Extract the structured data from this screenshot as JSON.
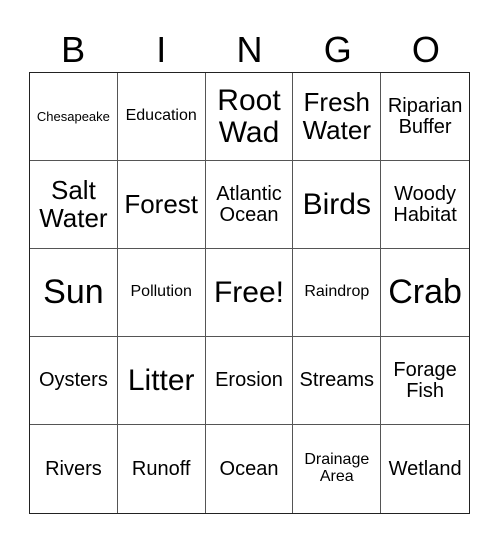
{
  "header": [
    "B",
    "I",
    "N",
    "G",
    "O"
  ],
  "cells": [
    {
      "text": "Chesapeake",
      "size": "s-xs"
    },
    {
      "text": "Education",
      "size": "s-sm"
    },
    {
      "text": "Root Wad",
      "size": "s-xl"
    },
    {
      "text": "Fresh Water",
      "size": "s-lg"
    },
    {
      "text": "Riparian Buffer",
      "size": "s-md"
    },
    {
      "text": "Salt Water",
      "size": "s-lg"
    },
    {
      "text": "Forest",
      "size": "s-lg"
    },
    {
      "text": "Atlantic Ocean",
      "size": "s-md"
    },
    {
      "text": "Birds",
      "size": "s-xl"
    },
    {
      "text": "Woody Habitat",
      "size": "s-md"
    },
    {
      "text": "Sun",
      "size": "s-xxl"
    },
    {
      "text": "Pollution",
      "size": "s-sm"
    },
    {
      "text": "Free!",
      "size": "s-xl"
    },
    {
      "text": "Raindrop",
      "size": "s-sm"
    },
    {
      "text": "Crab",
      "size": "s-xxl"
    },
    {
      "text": "Oysters",
      "size": "s-md"
    },
    {
      "text": "Litter",
      "size": "s-xl"
    },
    {
      "text": "Erosion",
      "size": "s-md"
    },
    {
      "text": "Streams",
      "size": "s-md"
    },
    {
      "text": "Forage Fish",
      "size": "s-md"
    },
    {
      "text": "Rivers",
      "size": "s-md"
    },
    {
      "text": "Runoff",
      "size": "s-md"
    },
    {
      "text": "Ocean",
      "size": "s-md"
    },
    {
      "text": "Drainage Area",
      "size": "s-sm"
    },
    {
      "text": "Wetland",
      "size": "s-md"
    }
  ]
}
